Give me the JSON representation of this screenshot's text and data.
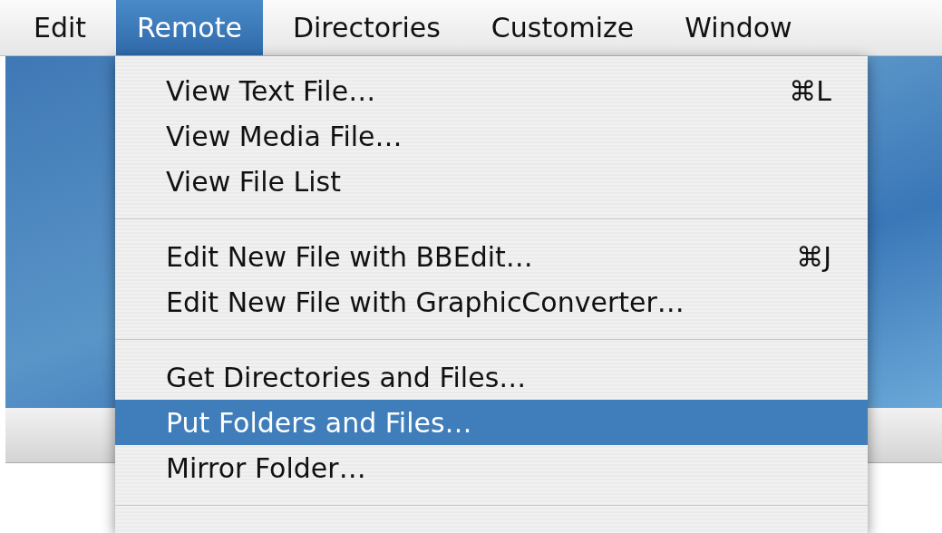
{
  "menu_bar": [
    {
      "label": "Edit",
      "selected": false
    },
    {
      "label": "Remote",
      "selected": true
    },
    {
      "label": "Directories",
      "selected": false
    },
    {
      "label": "Customize",
      "selected": false
    },
    {
      "label": "Window",
      "selected": false
    }
  ],
  "menu": [
    {
      "kind": "item",
      "label": "View Text File…",
      "shortcut": "⌘L",
      "selected": false
    },
    {
      "kind": "item",
      "label": "View Media File…",
      "selected": false
    },
    {
      "kind": "item",
      "label": "View File List",
      "selected": false
    },
    {
      "kind": "separator"
    },
    {
      "kind": "item",
      "label": "Edit New File with BBEdit…",
      "shortcut": "⌘J",
      "selected": false
    },
    {
      "kind": "item",
      "label": "Edit New File with GraphicConverter…",
      "selected": false
    },
    {
      "kind": "separator"
    },
    {
      "kind": "item",
      "label": "Get Directories and Files…",
      "selected": false
    },
    {
      "kind": "item",
      "label": "Put Folders and Files…",
      "selected": true
    },
    {
      "kind": "item",
      "label": "Mirror Folder…",
      "selected": false
    },
    {
      "kind": "separator"
    }
  ]
}
